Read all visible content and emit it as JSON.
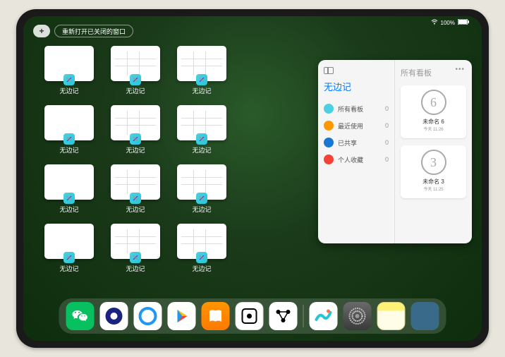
{
  "status": {
    "battery": "100%"
  },
  "top": {
    "plus": "+",
    "reopen_label": "重新打开已关闭的窗口"
  },
  "app_label": "无边记",
  "thumbs": [
    {
      "variant": "blank"
    },
    {
      "variant": "cal"
    },
    {
      "variant": "cal"
    },
    {
      "variant": "blank"
    },
    {
      "variant": "cal"
    },
    {
      "variant": "cal"
    },
    {
      "variant": "blank"
    },
    {
      "variant": "cal"
    },
    {
      "variant": "cal"
    },
    {
      "variant": "blank"
    },
    {
      "variant": "cal"
    },
    {
      "variant": "cal"
    }
  ],
  "panel": {
    "title": "无边记",
    "items": [
      {
        "icon": "ic1",
        "label": "所有看板",
        "count": "0"
      },
      {
        "icon": "ic2",
        "label": "最近使用",
        "count": "0"
      },
      {
        "icon": "ic3",
        "label": "已共享",
        "count": "0"
      },
      {
        "icon": "ic4",
        "label": "个人收藏",
        "count": "0"
      }
    ],
    "right_title": "所有看板",
    "boards": [
      {
        "glyph": "6",
        "name": "未命名 6",
        "sub": "今天 11:26"
      },
      {
        "glyph": "3",
        "name": "未命名 3",
        "sub": "今天 11:25"
      }
    ]
  },
  "dock": {
    "apps": [
      "wechat",
      "quark-hd",
      "quark",
      "play",
      "books",
      "dice",
      "connections",
      "freeform",
      "settings",
      "notes",
      "app-library"
    ]
  }
}
